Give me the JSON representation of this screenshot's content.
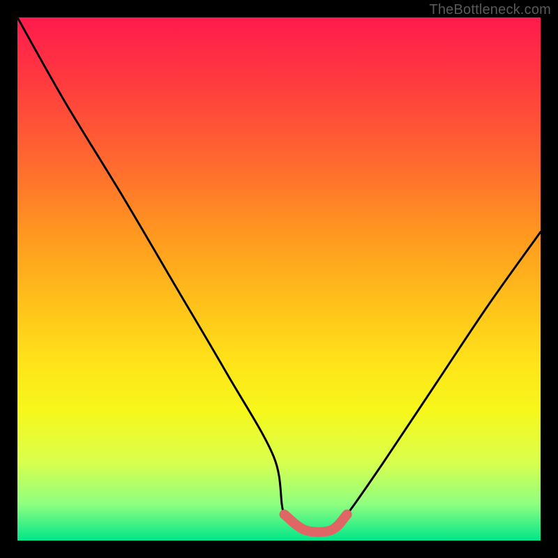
{
  "watermark": "TheBottleneck.com",
  "colors": {
    "background": "#000000",
    "curve": "#000000",
    "highlight": "#e06666",
    "gradient_top": "#ff1a4d",
    "gradient_bottom": "#00e68a"
  },
  "chart_data": {
    "type": "line",
    "title": "",
    "xlabel": "",
    "ylabel": "",
    "xlim": [
      0,
      100
    ],
    "ylim": [
      0,
      100
    ],
    "grid": false,
    "legend": false,
    "annotations": [
      {
        "text": "TheBottleneck.com",
        "position": "top-right"
      }
    ],
    "series": [
      {
        "name": "bottleneck-curve",
        "x": [
          0,
          9,
          20,
          30,
          40,
          49,
          51,
          55,
          60,
          63,
          70,
          80,
          90,
          100
        ],
        "values": [
          100,
          84,
          66,
          49,
          32,
          16,
          5,
          2,
          2,
          5,
          15,
          30,
          45,
          59
        ]
      },
      {
        "name": "optimal-range-highlight",
        "x": [
          51,
          55,
          60,
          63
        ],
        "values": [
          5,
          2,
          2,
          5
        ]
      }
    ]
  }
}
